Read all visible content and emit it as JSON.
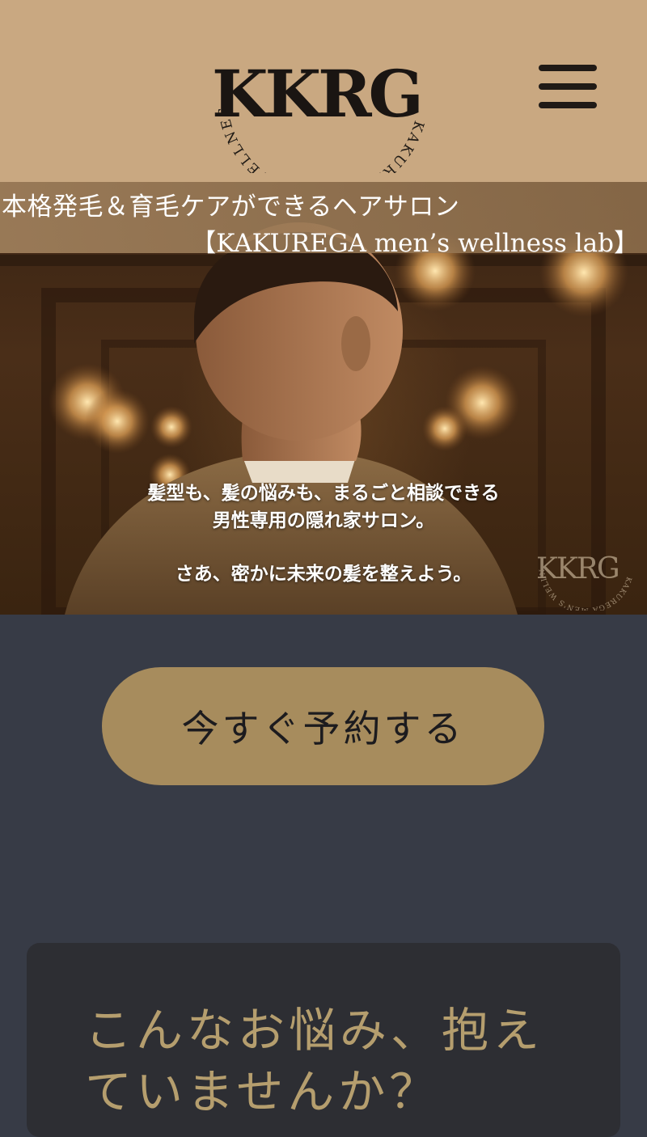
{
  "header": {
    "logo_text": "KKRG",
    "logo_ring_text": "KAKUREGA MEN'S WELLNES LAB"
  },
  "hero": {
    "title_line1": "本格発毛＆育毛ケアができるヘアサロン",
    "title_line2": "【KAKUREGA men’s wellness lab】",
    "copy_line1": "髪型も、髪の悩みも、まるごと相談できる",
    "copy_line2": "男性専用の隠れ家サロン。",
    "copy_line3": "さあ、密かに未来の髪を整えよう。",
    "watermark_text": "KKRG",
    "watermark_ring_text": "KAKUREGA MEN'S WELLNES LAB"
  },
  "reserve": {
    "label": "今すぐ予約する"
  },
  "worries": {
    "title": "こんなお悩み、抱えていませんか？"
  },
  "colors": {
    "header_bg": "#c9a881",
    "page_bg": "#373b46",
    "button_bg": "#a78c5d",
    "card_bg": "#2d2e33",
    "accent_text": "#b59e6e"
  },
  "icons": {
    "menu": "hamburger-menu-icon"
  }
}
